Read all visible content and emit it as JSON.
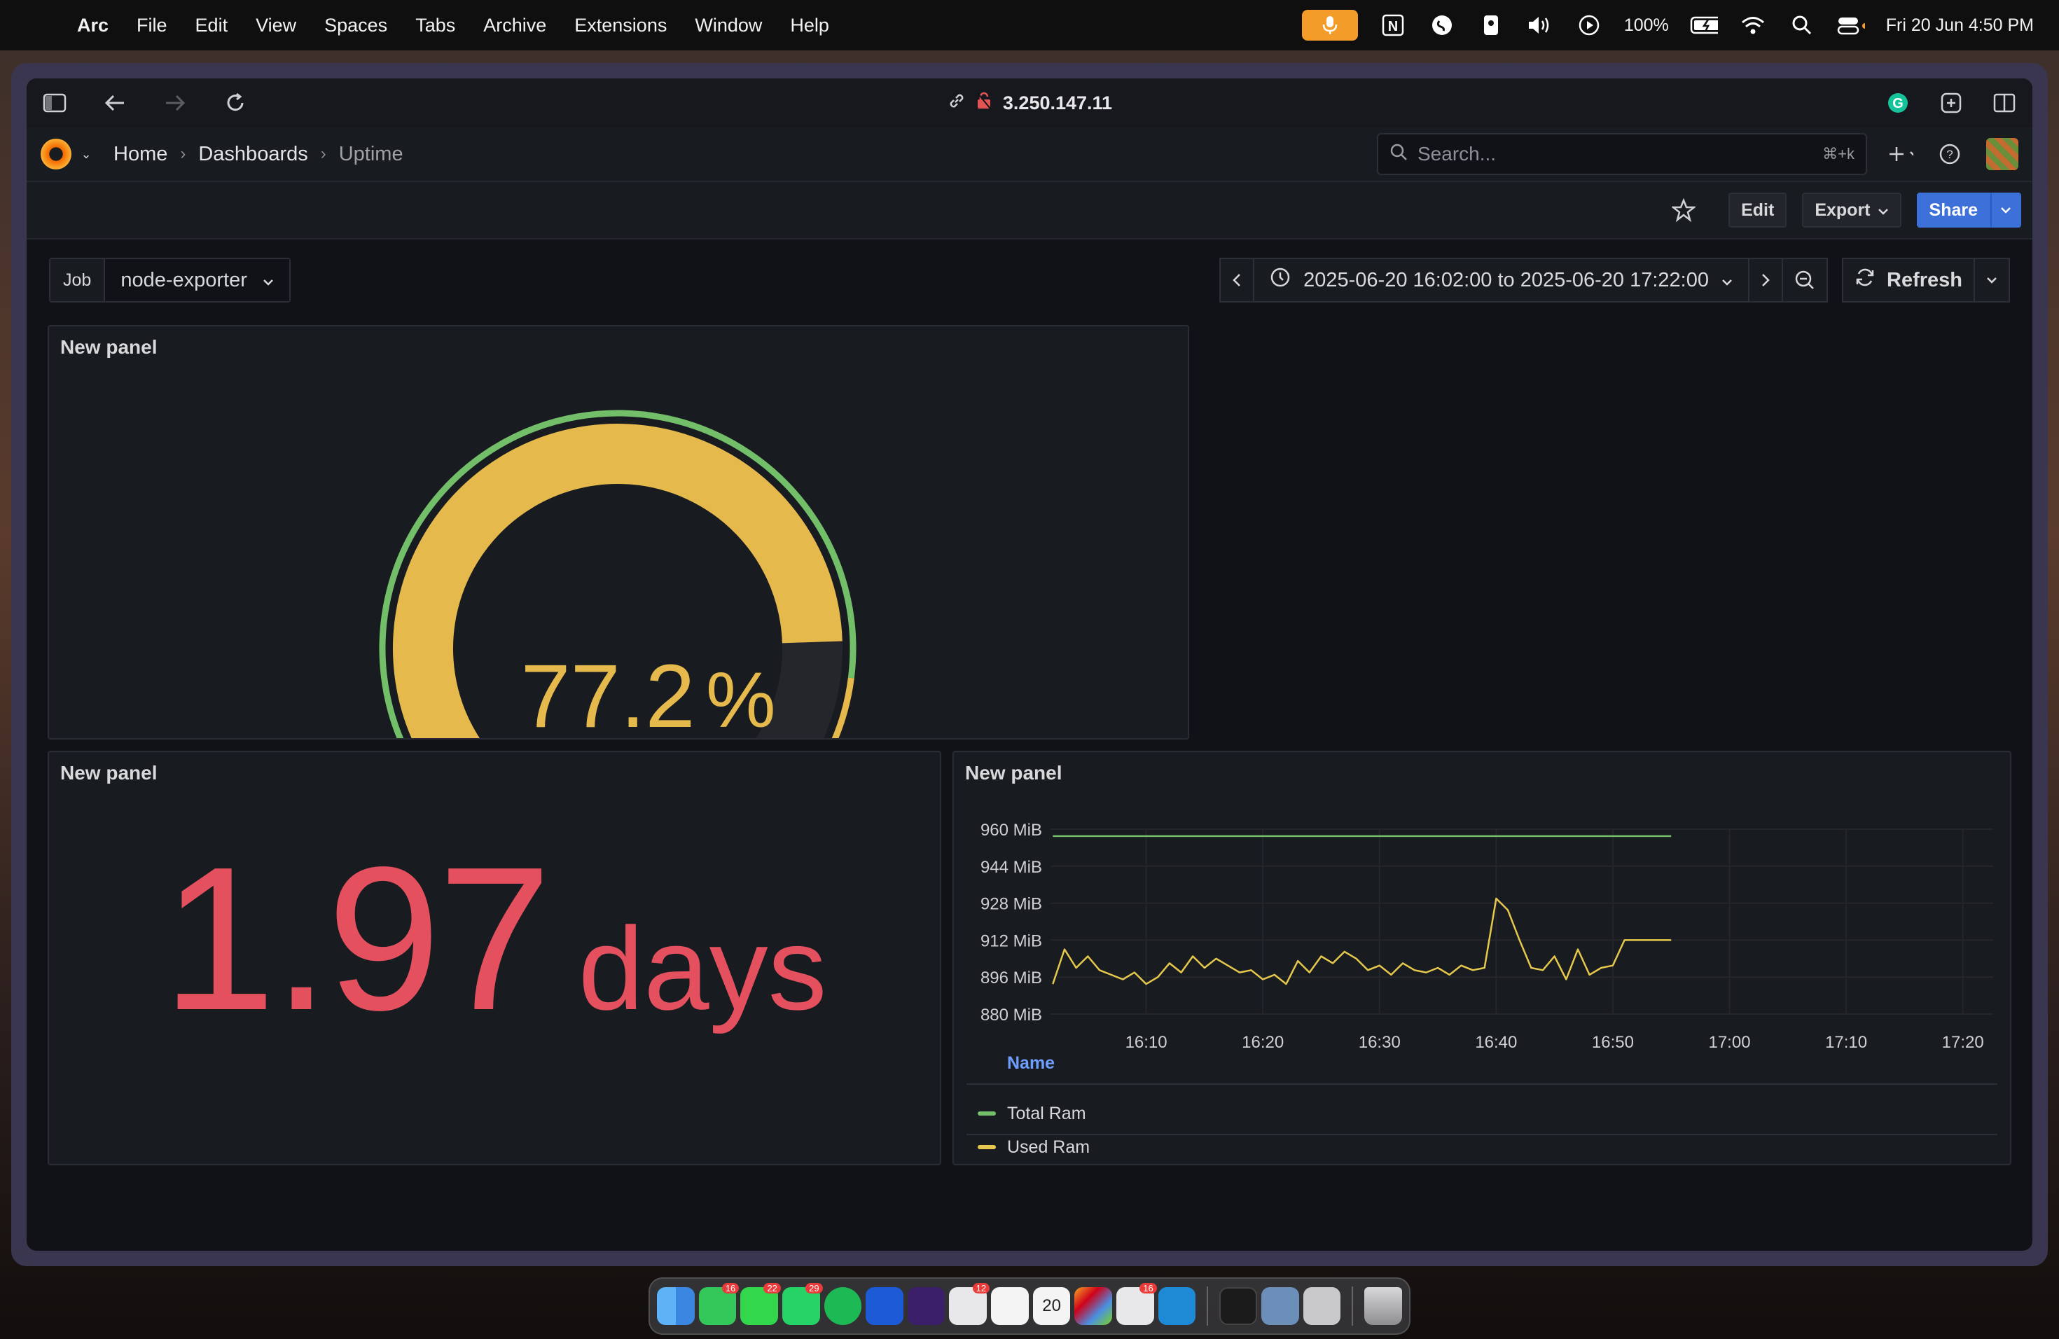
{
  "menubar": {
    "app": "Arc",
    "items": [
      "File",
      "Edit",
      "View",
      "Spaces",
      "Tabs",
      "Archive",
      "Extensions",
      "Window",
      "Help"
    ],
    "battery": "100%",
    "datetime": "Fri 20 Jun  4:50 PM"
  },
  "browser": {
    "url": "3.250.147.11"
  },
  "grafana": {
    "breadcrumb": [
      "Home",
      "Dashboards",
      "Uptime"
    ],
    "search_placeholder": "Search...",
    "search_shortcut": "⌘+k",
    "toolbar": {
      "edit": "Edit",
      "export": "Export",
      "share": "Share"
    },
    "variables": [
      {
        "label": "Job",
        "value": "node-exporter"
      }
    ],
    "time_range": "2025-06-20 16:02:00 to 2025-06-20 17:22:00",
    "refresh": "Refresh"
  },
  "panels": {
    "gauge": {
      "title": "New panel",
      "value": 77.2,
      "display": "77.2",
      "unit": "%",
      "colors": {
        "value": "#e6b94c",
        "green": "#73bf69",
        "yellow": "#e6b94c",
        "red": "#e5505f",
        "track": "#25262b"
      }
    },
    "stat": {
      "title": "New panel",
      "value": "1.97",
      "unit": "days",
      "color": "#e5505f"
    },
    "timeseries": {
      "title": "New panel",
      "legend_header": "Name"
    }
  },
  "chart_data": {
    "type": "line",
    "x_ticks": [
      "16:10",
      "16:20",
      "16:30",
      "16:40",
      "16:50",
      "17:00",
      "17:10",
      "17:20"
    ],
    "y_ticks": [
      "960 MiB",
      "944 MiB",
      "928 MiB",
      "912 MiB",
      "896 MiB",
      "880 MiB"
    ],
    "ylim": [
      880,
      960
    ],
    "xlim_minutes": [
      16.03,
      17.37
    ],
    "grid": true,
    "legend": "bottom",
    "series": [
      {
        "name": "Total Ram",
        "color": "#73bf69",
        "x": [
          "16:02",
          "16:55"
        ],
        "values": [
          957,
          957
        ]
      },
      {
        "name": "Used Ram",
        "color": "#e6c84c",
        "x": [
          "16:02",
          "16:03",
          "16:04",
          "16:05",
          "16:06",
          "16:07",
          "16:08",
          "16:09",
          "16:10",
          "16:11",
          "16:12",
          "16:13",
          "16:14",
          "16:15",
          "16:16",
          "16:17",
          "16:18",
          "16:19",
          "16:20",
          "16:21",
          "16:22",
          "16:23",
          "16:24",
          "16:25",
          "16:26",
          "16:27",
          "16:28",
          "16:29",
          "16:30",
          "16:31",
          "16:32",
          "16:33",
          "16:34",
          "16:35",
          "16:36",
          "16:37",
          "16:38",
          "16:39",
          "16:40",
          "16:41",
          "16:42",
          "16:43",
          "16:44",
          "16:45",
          "16:46",
          "16:47",
          "16:48",
          "16:49",
          "16:50",
          "16:51",
          "16:55"
        ],
        "values": [
          893,
          908,
          900,
          905,
          899,
          897,
          895,
          898,
          893,
          896,
          902,
          898,
          905,
          900,
          904,
          901,
          898,
          899,
          895,
          897,
          893,
          903,
          898,
          905,
          902,
          907,
          904,
          899,
          901,
          897,
          902,
          899,
          898,
          900,
          897,
          901,
          899,
          900,
          930,
          925,
          912,
          900,
          899,
          905,
          895,
          908,
          897,
          900,
          901,
          912,
          912
        ]
      }
    ]
  },
  "dock": {
    "badges": [
      "16",
      "22",
      "29",
      "12",
      "16"
    ],
    "calendar_day": "20"
  }
}
